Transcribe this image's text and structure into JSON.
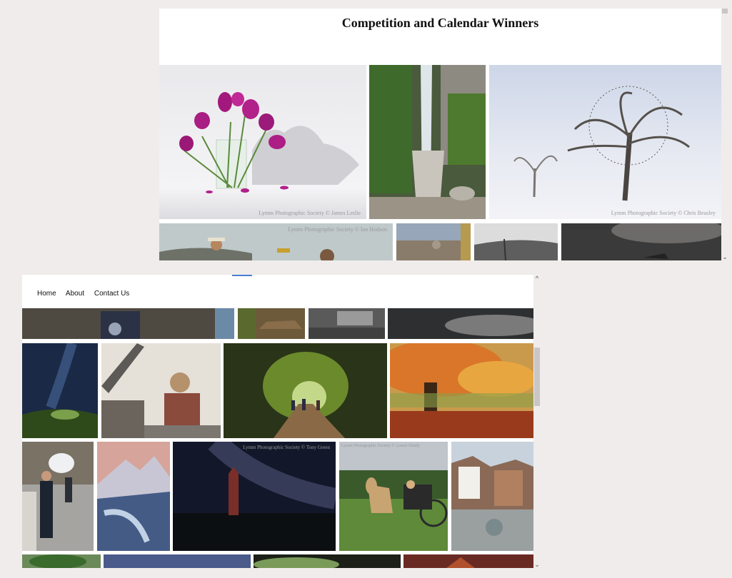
{
  "window1": {
    "title": "Competition and Calendar Winners",
    "credits": {
      "tulips": "Lymm Photographic Society © James Leslie",
      "tree": "Lymm Photographic Society © Chris Beasley",
      "musician": "Lymm Photographic Society © Ian Hodson"
    }
  },
  "window2": {
    "nav": {
      "home": "Home",
      "about": "About",
      "contact": "Contact Us"
    },
    "credits": {
      "stars": "Lymm Photographic Society © Tony Green",
      "horse": "Lymm Photographic Society © Louise Handy"
    }
  },
  "scrollbar": {
    "up_glyph": "^",
    "down_glyph": "⌄"
  },
  "colors": {
    "page_bg": "#efeceb",
    "nav_accent": "#4a7fd0"
  },
  "photos": [
    "tulips-in-vase",
    "waterfall",
    "misty-winter-tree",
    "musician-saxophone",
    "city-panorama",
    "mountain-landscape",
    "dark-storm-plane",
    "band-musicians",
    "cottage",
    "bw-cart",
    "storm-sky",
    "milky-way-night",
    "giant-puppet-crane",
    "tree-tunnel-walkers",
    "autumn-tree",
    "man-vaping",
    "snowy-mountain-pink-sky",
    "lighthouse-milky-way",
    "horse-and-carriage",
    "coastal-village",
    "green-trees",
    "blue-sky",
    "dark-treeline",
    "red-church-window"
  ]
}
